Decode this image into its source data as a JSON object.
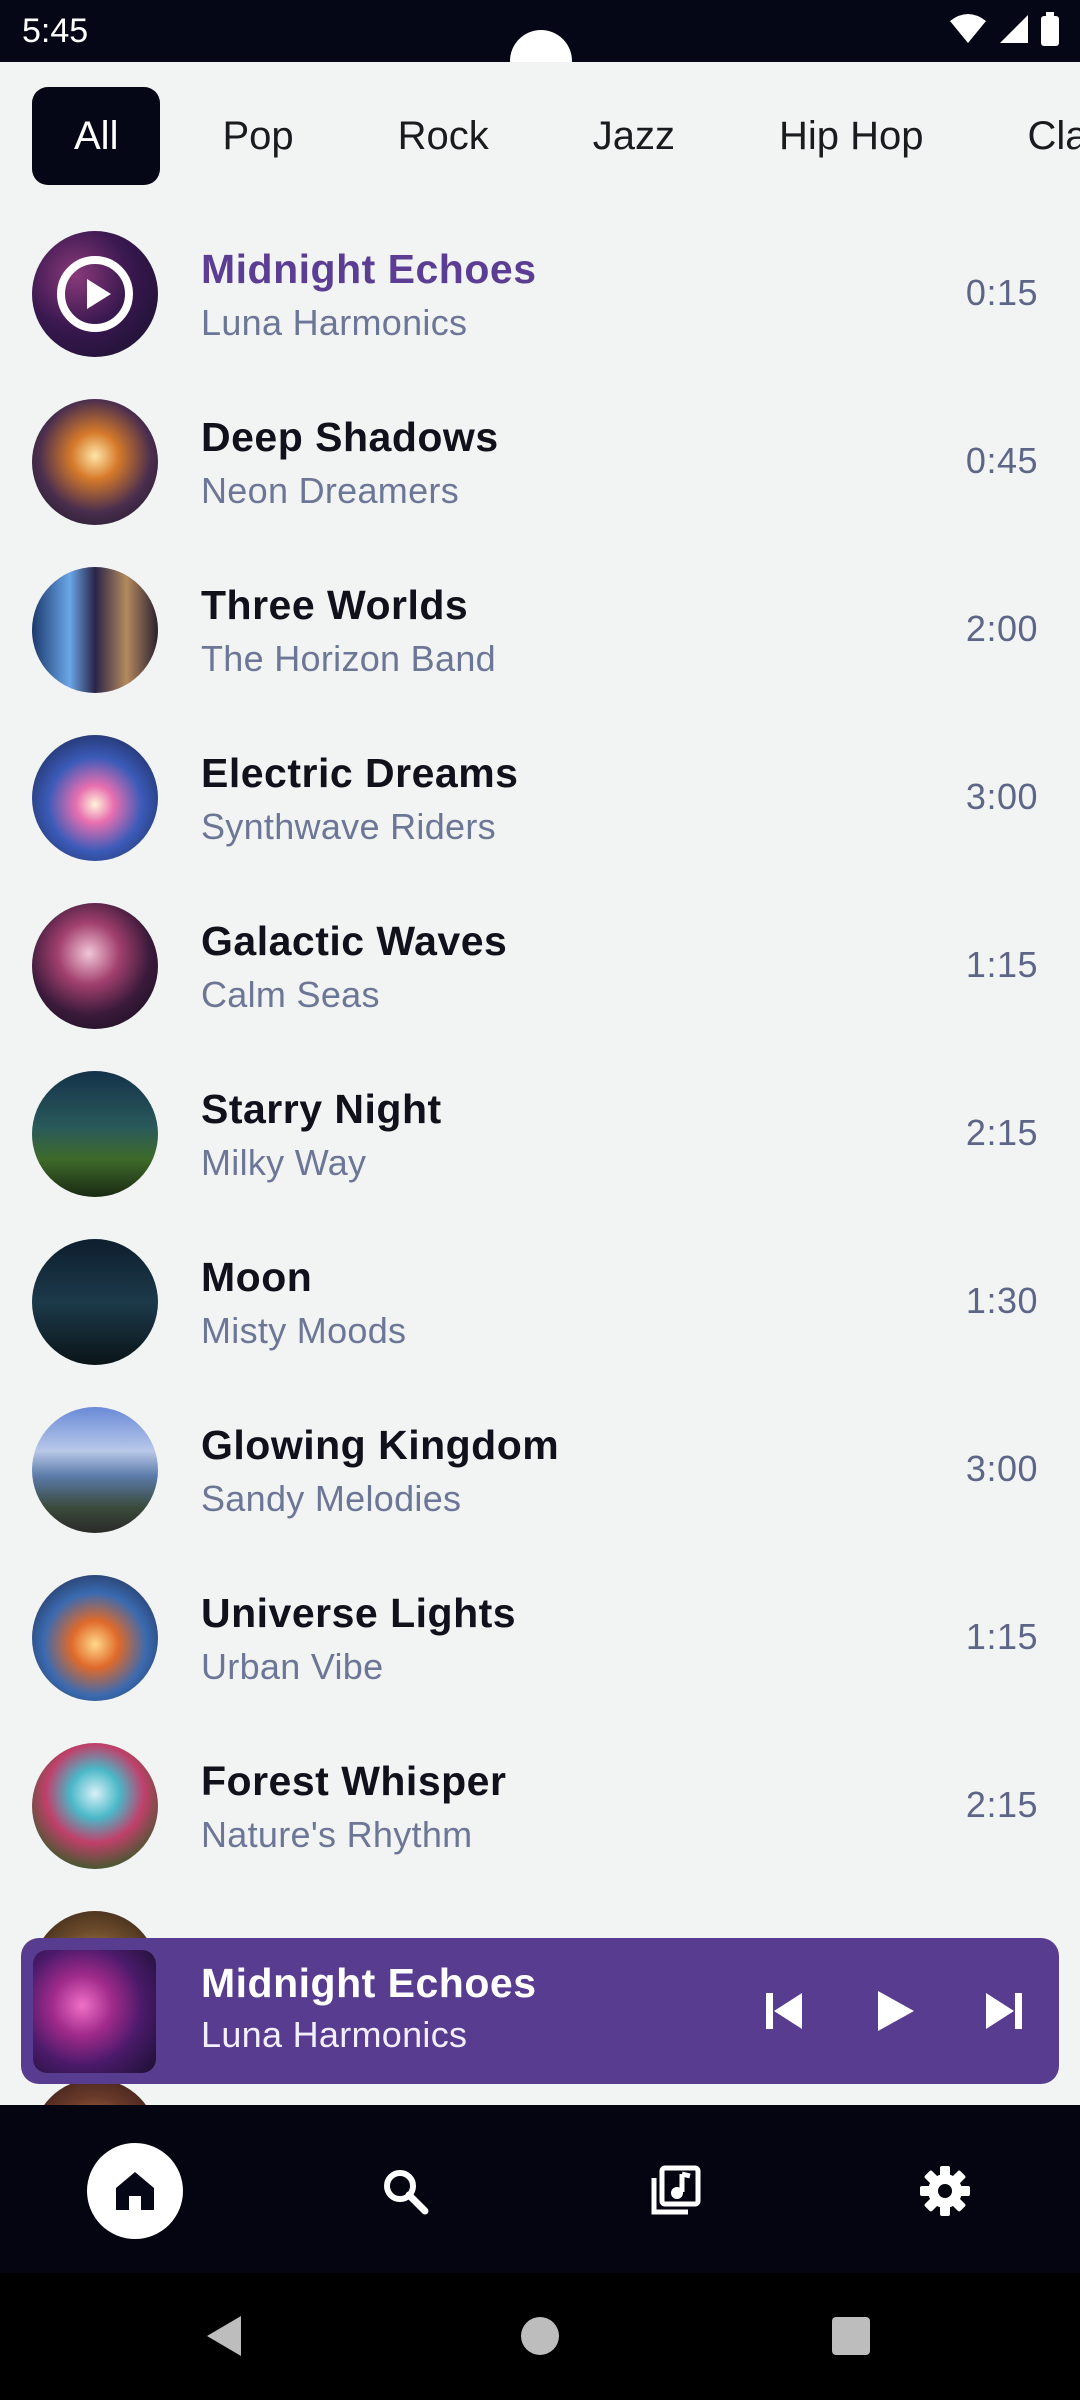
{
  "status_bar": {
    "time": "5:45"
  },
  "chips": [
    "All",
    "Pop",
    "Rock",
    "Jazz",
    "Hip Hop",
    "Classic"
  ],
  "songs": [
    {
      "title": "Midnight Echoes",
      "artist": "Luna Harmonics",
      "duration": "0:15"
    },
    {
      "title": "Deep Shadows",
      "artist": "Neon Dreamers",
      "duration": "0:45"
    },
    {
      "title": "Three Worlds",
      "artist": "The Horizon Band",
      "duration": "2:00"
    },
    {
      "title": "Electric Dreams",
      "artist": "Synthwave Riders",
      "duration": "3:00"
    },
    {
      "title": "Galactic Waves",
      "artist": "Calm Seas",
      "duration": "1:15"
    },
    {
      "title": "Starry Night",
      "artist": "Milky Way",
      "duration": "2:15"
    },
    {
      "title": "Moon",
      "artist": "Misty Moods",
      "duration": "1:30"
    },
    {
      "title": "Glowing Kingdom",
      "artist": "Sandy Melodies",
      "duration": "3:00"
    },
    {
      "title": "Universe Lights",
      "artist": "Urban Vibe",
      "duration": "1:15"
    },
    {
      "title": "Forest Whisper",
      "artist": "Nature's Rhythm",
      "duration": "2:15"
    }
  ],
  "now_playing": {
    "title": "Midnight Echoes",
    "artist": "Luna Harmonics"
  },
  "colors": {
    "accent": "#583c90",
    "dark": "#050716",
    "background": "#f2f4f3"
  },
  "icons": {
    "mini": [
      "skip-previous-icon",
      "play-icon",
      "skip-next-icon"
    ],
    "nav": [
      "home-icon",
      "search-icon",
      "library-music-icon",
      "settings-icon"
    ]
  }
}
